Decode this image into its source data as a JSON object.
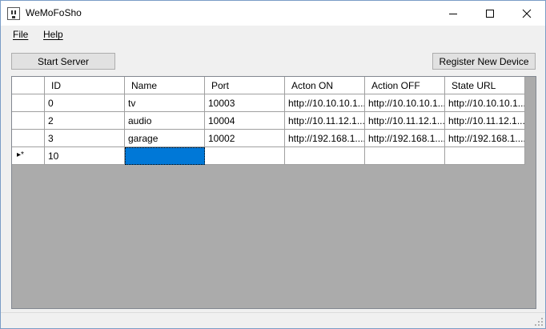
{
  "window": {
    "title": "WeMoFoSho"
  },
  "menu": {
    "file": "File",
    "help": "Help"
  },
  "toolbar": {
    "start_server": "Start Server",
    "register_device": "Register New Device"
  },
  "table": {
    "columns": [
      "ID",
      "Name",
      "Port",
      "Acton ON",
      "Action OFF",
      "State URL"
    ],
    "rows": [
      [
        "0",
        "tv",
        "10003",
        "http://10.10.10.1...",
        "http://10.10.10.1...",
        "http://10.10.10.1..."
      ],
      [
        "2",
        "audio",
        "10004",
        "http://10.11.12.1...",
        "http://10.11.12.1...",
        "http://10.11.12.1..."
      ],
      [
        "3",
        "garage",
        "10002",
        "http://192.168.1....",
        "http://192.168.1....",
        "http://192.168.1...."
      ]
    ],
    "new_row": {
      "marker": "▸*",
      "id": "10",
      "name": "",
      "port": "",
      "on": "",
      "off": "",
      "state": ""
    }
  },
  "colors": {
    "selection": "#0078d7",
    "grid_bg": "#ababab"
  }
}
